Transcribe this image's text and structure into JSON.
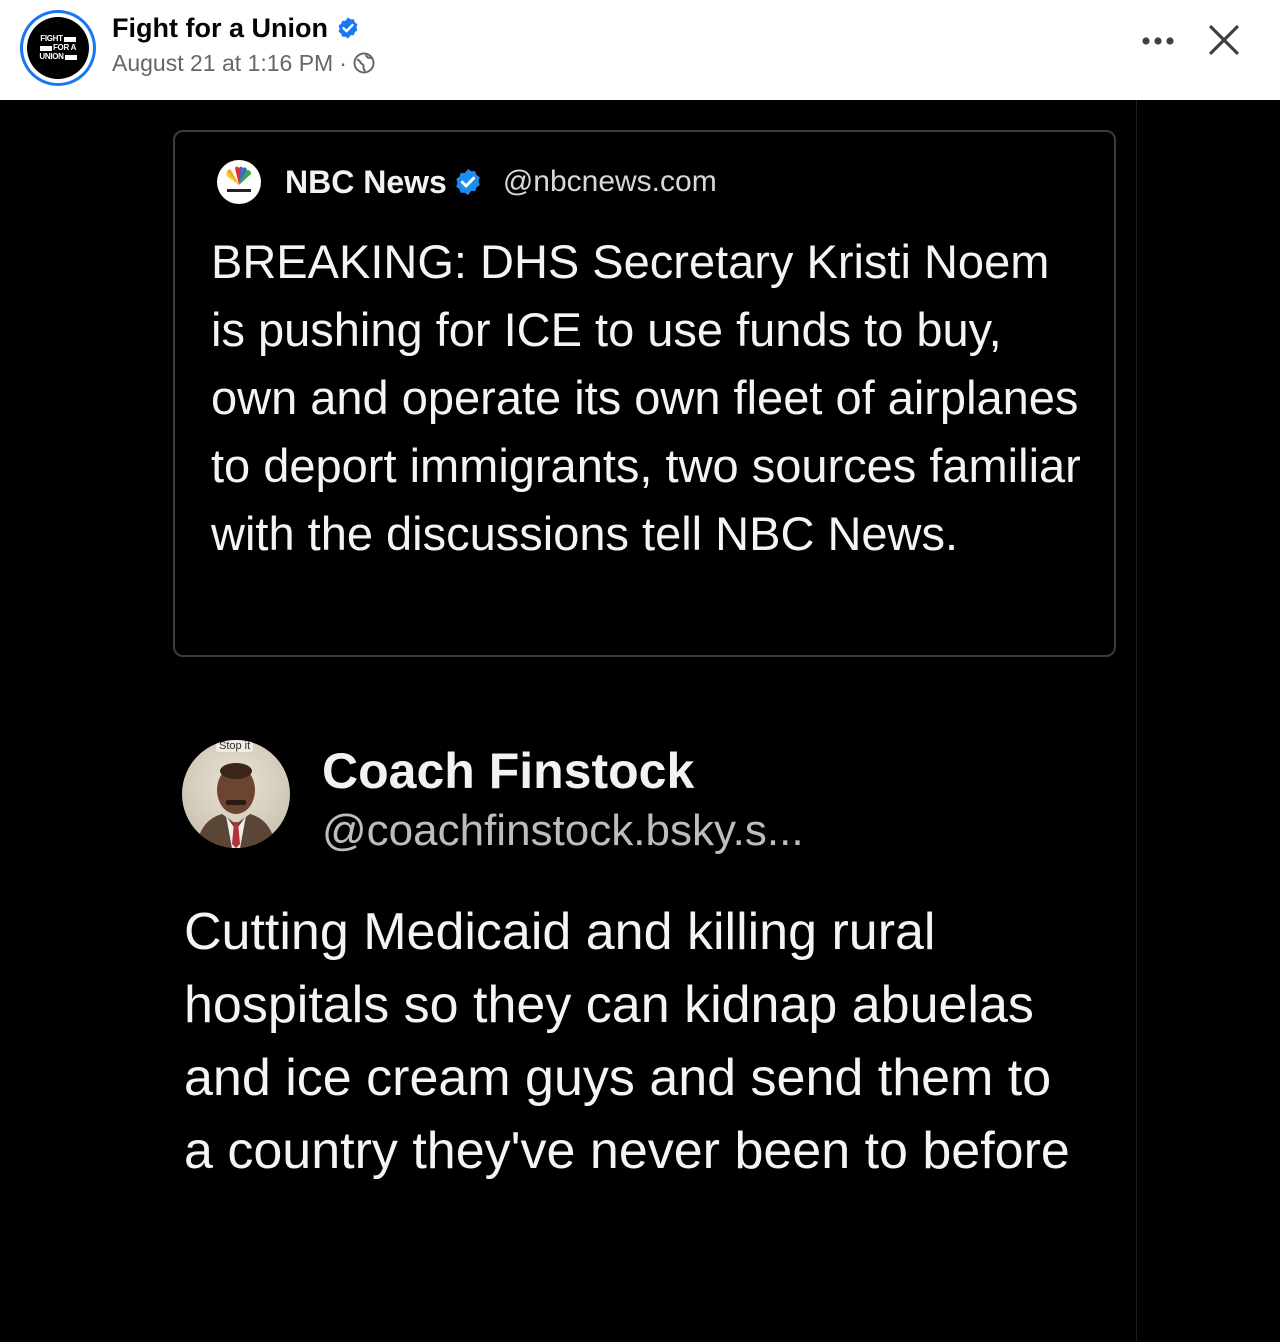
{
  "post": {
    "page_name": "Fight for a Union",
    "avatar_logo_lines": [
      "FIGHT",
      "FOR A",
      "UNION"
    ],
    "timestamp": "August 21 at 1:16 PM",
    "separator": "·",
    "audience_icon": "globe-icon",
    "more_icon": "more-options-icon",
    "close_icon": "close-icon"
  },
  "image": {
    "quoted_post": {
      "author_name": "NBC News",
      "handle": "@nbcnews.com",
      "avatar_icon": "nbc-peacock-logo",
      "text": "BREAKING: DHS Secretary Kristi Noem is pushing for ICE to use funds to buy, own and operate its own fleet of airplanes to deport immigrants, two sources familiar with the discussions tell NBC News."
    },
    "reply": {
      "author_name": "Coach Finstock",
      "handle": "@coachfinstock.bsky.s...",
      "avatar_caption": "Stop it",
      "text": "Cutting Medicaid and killing rural hospitals so they can kidnap abuelas and ice cream guys and send them to a country they've never been to before"
    }
  },
  "colors": {
    "verified_blue": "#1877f2",
    "image_background": "#000000",
    "secondary_text": "#65676b"
  }
}
